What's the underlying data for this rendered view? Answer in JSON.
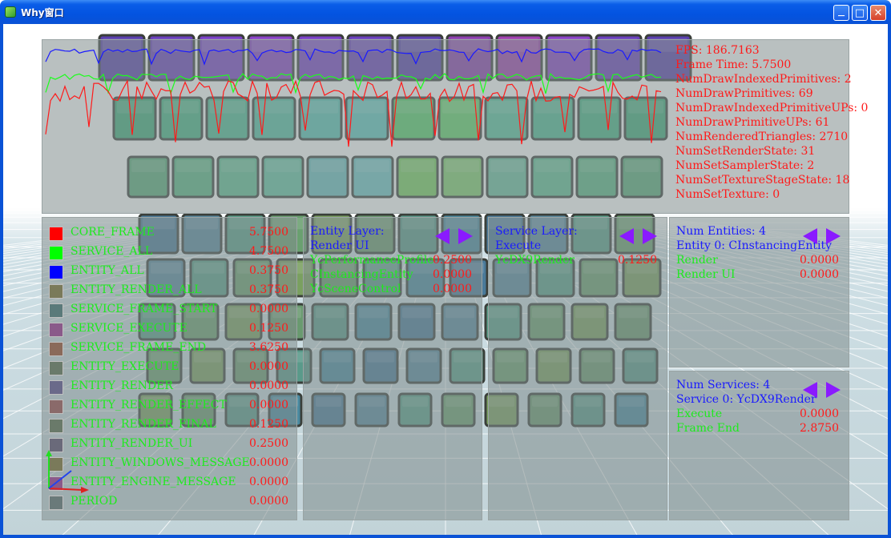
{
  "window": {
    "title": "Why窗口",
    "accent": "#0a52d6"
  },
  "stats": [
    "FPS: 186.7163",
    "Frame Time: 5.7500",
    "NumDrawIndexedPrimitives: 2",
    "NumDrawPrimitives: 69",
    "NumDrawIndexedPrimitiveUPs: 0",
    "NumDrawPrimitiveUPs: 61",
    "NumRenderedTriangles: 2710",
    "NumSetRenderState: 31",
    "NumSetSamplerState: 2",
    "NumSetTextureStageState: 18",
    "NumSetTexture: 0"
  ],
  "profiler": [
    {
      "name": "CORE_FRAME",
      "value": "5.7500",
      "color": "#ff0000"
    },
    {
      "name": "SERVICE_ALL",
      "value": "4.7500",
      "color": "#00ff00"
    },
    {
      "name": "ENTITY_ALL",
      "value": "0.3750",
      "color": "#0000ff"
    },
    {
      "name": "ENTITY_RENDER_ALL",
      "value": "0.3750",
      "color": "#7a7a5a"
    },
    {
      "name": "SERVICE_FRAME_START",
      "value": "0.0000",
      "color": "#5a7a7a"
    },
    {
      "name": "SERVICE_EXECUTE",
      "value": "0.1250",
      "color": "#8a5a8a"
    },
    {
      "name": "SERVICE_FRAME_END",
      "value": "3.6250",
      "color": "#8a6a5a"
    },
    {
      "name": "ENTITY_EXECUTE",
      "value": "0.0000",
      "color": "#6a7a6a"
    },
    {
      "name": "ENTITY_RENDER",
      "value": "0.0000",
      "color": "#6a6a8a"
    },
    {
      "name": "ENTITY_RENDER_EFFECT",
      "value": "0.0000",
      "color": "#8a6a6a"
    },
    {
      "name": "ENTITY_RENDER_FINAL",
      "value": "0.1250",
      "color": "#6a7a6a"
    },
    {
      "name": "ENTITY_RENDER_UI",
      "value": "0.2500",
      "color": "#6a6a7a"
    },
    {
      "name": "ENTITY_WINDOWS_MESSAGE",
      "value": "0.0000",
      "color": "#7a7a5a"
    },
    {
      "name": "ENTITY_ENGINE_MESSAGE",
      "value": "0.0000",
      "color": "#8a5a8a"
    },
    {
      "name": "PERIOD",
      "value": "0.0000",
      "color": "#6a7a7a"
    }
  ],
  "entity_layer": {
    "title": "Entity Layer:",
    "subtitle": "Render UI",
    "rows": [
      {
        "name": "YcPerformanceProfile",
        "value": "0.2500"
      },
      {
        "name": "CInstancingEntity",
        "value": "0.0000"
      },
      {
        "name": "YcSceneControl",
        "value": "0.0000"
      }
    ]
  },
  "service_layer": {
    "title": "Service Layer:",
    "subtitle": "Execute",
    "rows": [
      {
        "name": "YcDX9Render",
        "value": "0.1250"
      }
    ]
  },
  "entities_panel": {
    "title": "Num Entities: 4",
    "subtitle": "Entity 0: CInstancingEntity",
    "rows": [
      {
        "name": "Render",
        "value": "0.0000"
      },
      {
        "name": "Render UI",
        "value": "0.0000"
      }
    ]
  },
  "services_panel": {
    "title": "Num Services: 4",
    "subtitle": "Service 0: YcDX9Render",
    "rows": [
      {
        "name": "Execute",
        "value": "0.0000"
      },
      {
        "name": "Frame End",
        "value": "2.8750"
      }
    ]
  }
}
